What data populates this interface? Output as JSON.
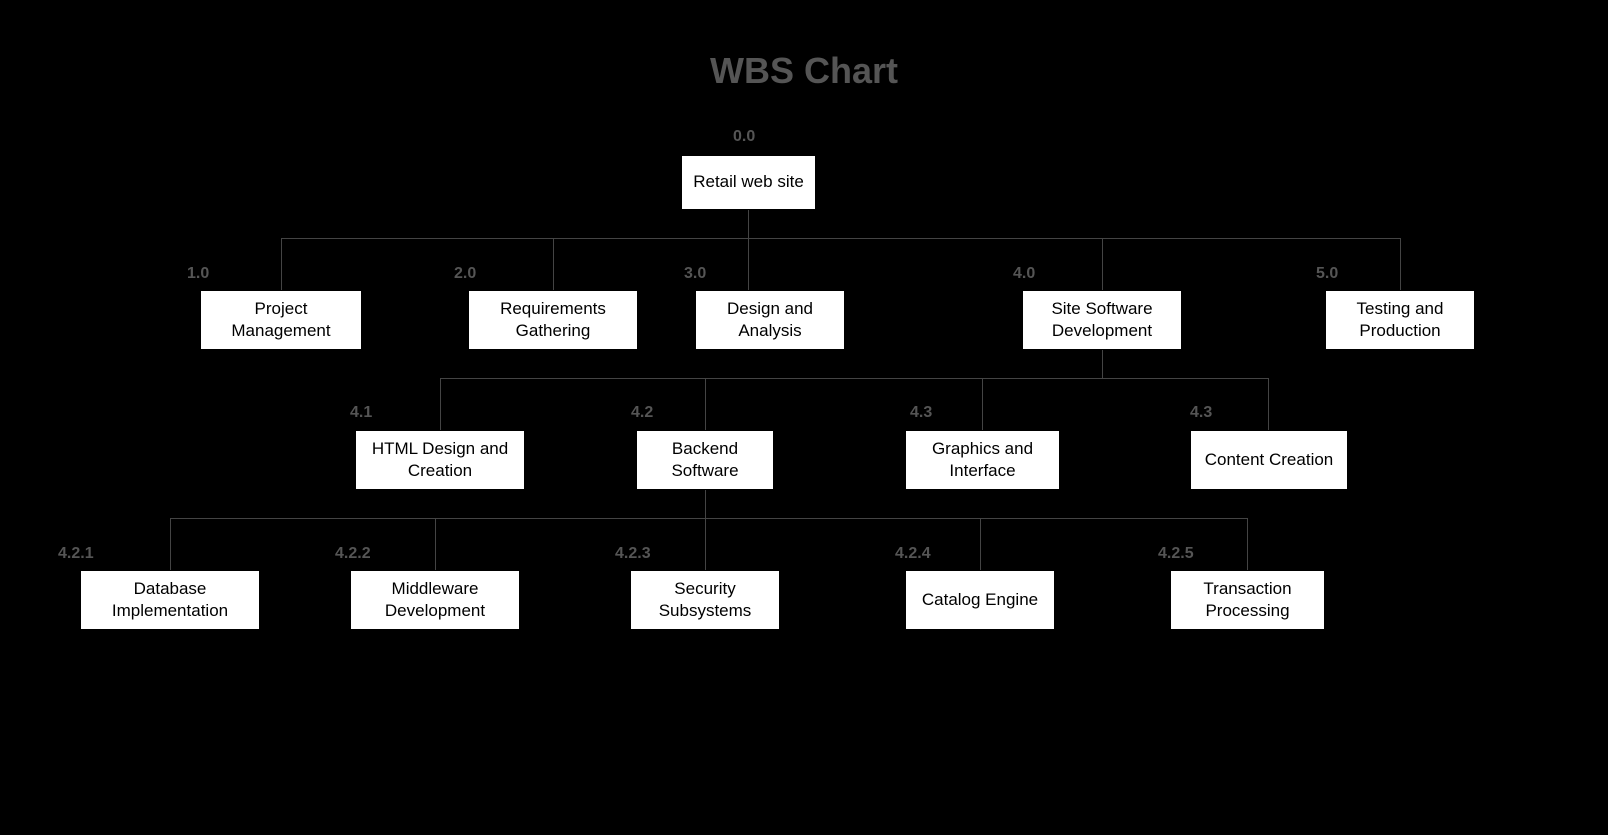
{
  "title": "WBS Chart",
  "root": {
    "num": "0.0",
    "label": "Retail web site"
  },
  "level1": [
    {
      "num": "1.0",
      "label": "Project Management"
    },
    {
      "num": "2.0",
      "label": "Requirements Gathering"
    },
    {
      "num": "3.0",
      "label": "Design and Analysis"
    },
    {
      "num": "4.0",
      "label": "Site Software Development"
    },
    {
      "num": "5.0",
      "label": "Testing and Production"
    }
  ],
  "level2": [
    {
      "num": "4.1",
      "label": "HTML Design and Creation"
    },
    {
      "num": "4.2",
      "label": "Backend Software"
    },
    {
      "num": "4.3",
      "label": "Graphics and Interface"
    },
    {
      "num": "4.3",
      "label": "Content Creation"
    }
  ],
  "level3": [
    {
      "num": "4.2.1",
      "label": "Database Implementation"
    },
    {
      "num": "4.2.2",
      "label": "Middleware Development"
    },
    {
      "num": "4.2.3",
      "label": "Security Subsystems"
    },
    {
      "num": "4.2.4",
      "label": "Catalog Engine"
    },
    {
      "num": "4.2.5",
      "label": "Transaction Processing"
    }
  ]
}
